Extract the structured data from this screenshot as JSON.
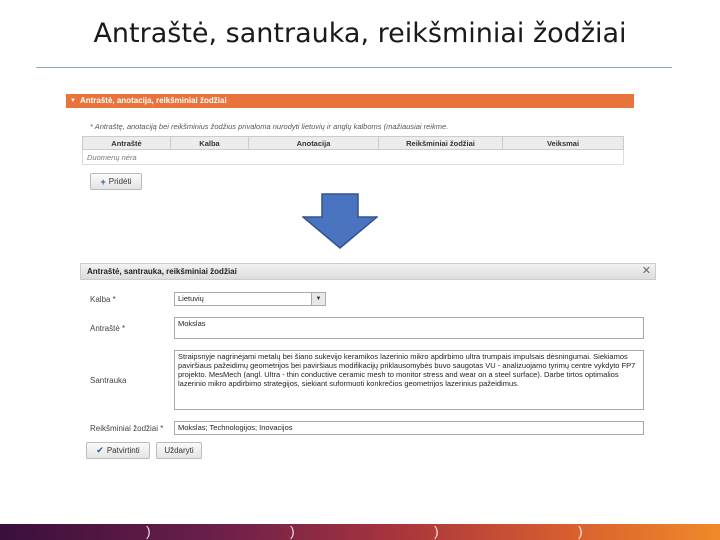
{
  "slide": {
    "title": "Antraštė, santrauka, reikšminiai žodžiai"
  },
  "panel": {
    "header": "Antraštė, anotacija, reikšminiai žodžiai",
    "note": "* Antraštę, anotaciją bei reikšminius žodžius privaloma nurodyti lietuvių ir anglų kalboms (mažiausiai reikme.",
    "columns": [
      "Antraštė",
      "Kalba",
      "Anotacija",
      "Reikšminiai žodžiai",
      "Veiksmai"
    ],
    "empty_text": "Duomenų nėra",
    "add_button": "Pridėti"
  },
  "dialog": {
    "title": "Antraštė, santrauka, reikšminiai žodžiai",
    "language_label": "Kalba *",
    "language_value": "Lietuvių",
    "title_label": "Antraštė *",
    "title_value": "Mokslas",
    "summary_label": "Santrauka",
    "summary_value": "Straipsnyje nagrinėjami metalų bei šiano sukevijo keramikos lazerinio mikro apdirbimo ultra trumpais impulsais dėsningumai. Siekiamos paviršiaus pažeidimų geometrijos bei paviršiaus modifikacijų priklausomybės buvo saugotas VU - analizuojamo tyrimų centre vykdyto FP7 projekto. MesMech (angl. Ultra - thin conductive ceramic mesh to monitor stress and wear on a steel surface). Darbe tirtos optimalios lazerinio mikro apdirbimo strategijos, siekiant suformuoti konkrečios geometrijos lazerinius pažeidimus.",
    "keywords_label": "Reikšminiai žodžiai *",
    "keywords_value": "Mokslas; Technologijos; Inovacijos",
    "confirm_button": "Patvirtinti",
    "close_button": "Uždaryti"
  },
  "colors": {
    "panel_header": "#e8743b",
    "arrow": "#4a74c0"
  }
}
